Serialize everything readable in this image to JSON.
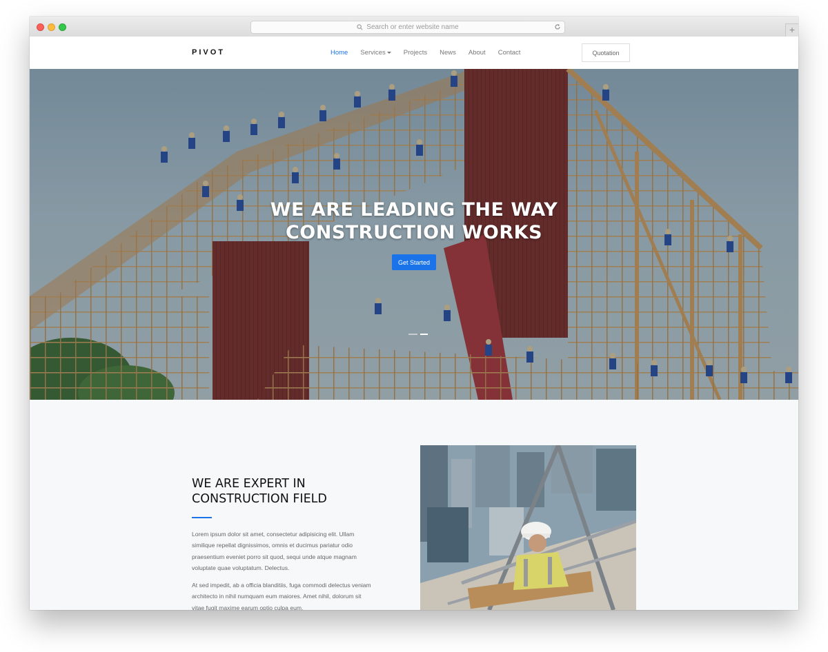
{
  "browser": {
    "url_placeholder": "Search or enter website name",
    "new_tab_symbol": "+"
  },
  "navbar": {
    "logo": "PIVOT",
    "links": [
      "Home",
      "Services",
      "Projects",
      "News",
      "About",
      "Contact"
    ],
    "active_link": "Home",
    "quotation_label": "Quotation"
  },
  "hero": {
    "title_line1": "WE ARE LEADING THE WAY",
    "title_line2": "CONSTRUCTION WORKS",
    "cta_label": "Get Started",
    "slides": 2,
    "active_slide": 2
  },
  "about": {
    "heading_line1": "WE ARE EXPERT IN",
    "heading_line2": "CONSTRUCTION FIELD",
    "paragraph1": "Lorem ipsum dolor sit amet, consectetur adipisicing elit. Ullam similique repellat dignissimos, omnis et ducimus pariatur odio praesentium eveniet porro sit quod, sequi unde atque magnam voluptate quae voluptatum. Delectus.",
    "paragraph2": "At sed impedit, ab a officia blanditiis, fuga commodi delectus veniam architecto in nihil numquam eum maiores. Amet nihil, dolorum sit vitae fugit maxime earum optio culpa eum."
  },
  "colors": {
    "accent": "#1a73e8",
    "hero_barn_red": "#7a2f2b",
    "timber": "#c9995e",
    "section_bg": "#f6f8fa"
  }
}
